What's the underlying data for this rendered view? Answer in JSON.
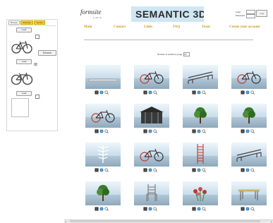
{
  "left_panel": {
    "tabs": [
      "Browse",
      "Structure",
      "Texture"
    ],
    "load_label": "Load",
    "search_label": "Search"
  },
  "site": {
    "logo": "formsite",
    "logo_sub": "LIRIS",
    "banner": "SEMANTIC 3D",
    "login": {
      "login_label": "Login",
      "password_label": "Password",
      "button": "Log"
    },
    "nav": [
      "Main",
      "Contact",
      "Links",
      "FAQ",
      "Team",
      "Create your account"
    ],
    "results_label": "Number of results by page",
    "results_value": "15"
  },
  "results": [
    "board",
    "bicycle",
    "bench",
    "bicycle",
    "bicycle",
    "gazebo",
    "tree",
    "tree",
    "fern",
    "bicycle",
    "ladder",
    "bench",
    "tree",
    "chair",
    "flowers",
    "table"
  ],
  "colors": {
    "tab_yellow": "#ffd21a",
    "nav_gold": "#c79a1e",
    "banner_blue": "#cfe6f4"
  }
}
